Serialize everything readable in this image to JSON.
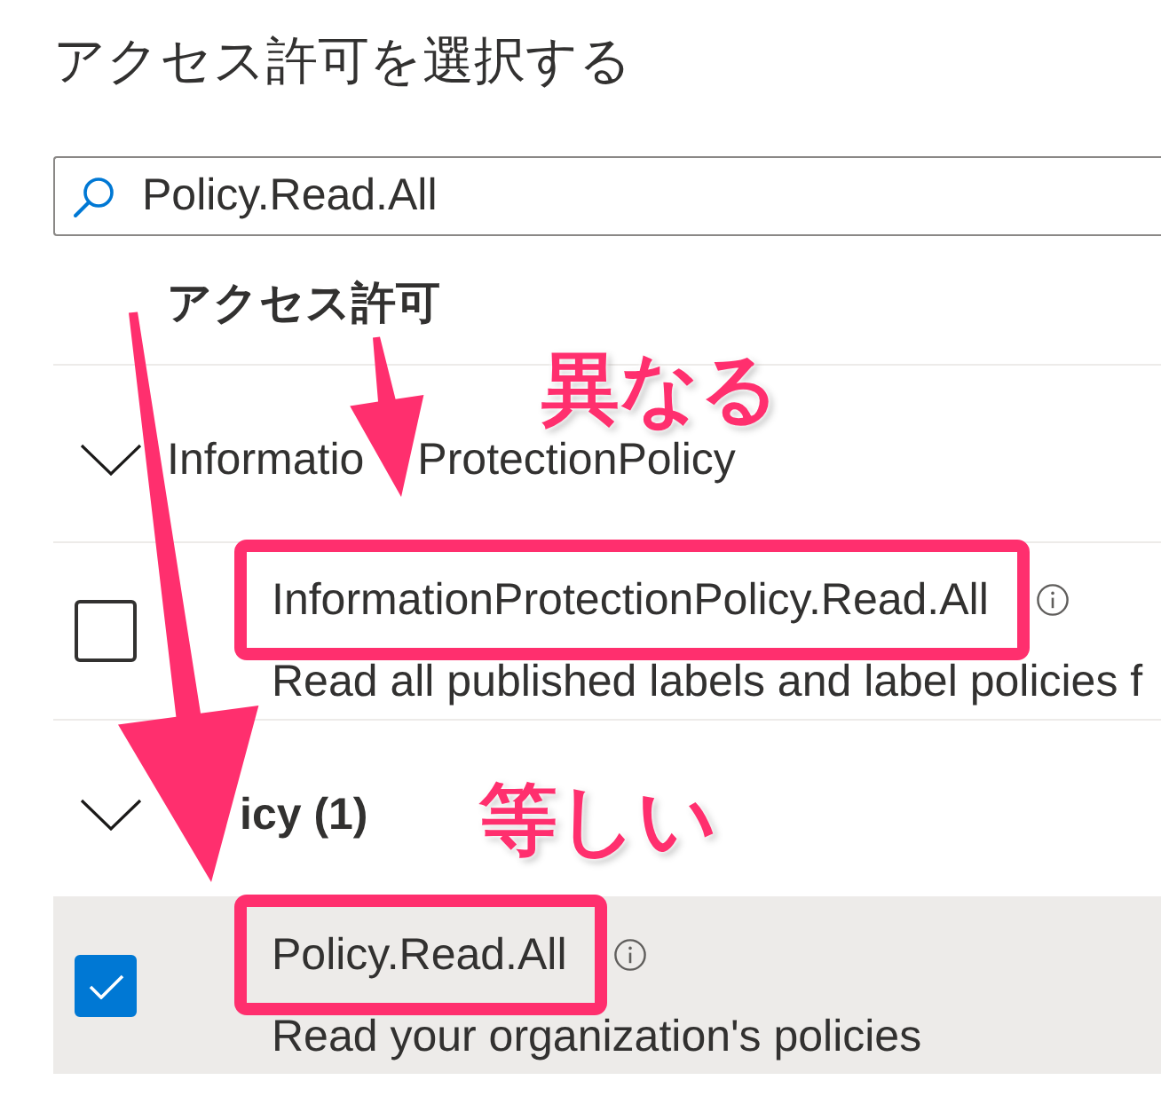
{
  "title": "アクセス許可を選択する",
  "search": {
    "value": "Policy.Read.All"
  },
  "column_header": "アクセス許可",
  "groups": [
    {
      "label_parts": [
        "Informatio",
        "ProtectionPolicy"
      ],
      "expanded": true,
      "callout": "異なる",
      "items": [
        {
          "name": "InformationProtectionPolicy.Read.All",
          "description": "Read all published labels and label policies f",
          "checked": false,
          "highlighted": true
        }
      ]
    },
    {
      "label_parts": [
        "icy (1)"
      ],
      "expanded": true,
      "callout": "等しい",
      "items": [
        {
          "name": "Policy.Read.All",
          "description": "Read your organization's policies",
          "checked": true,
          "highlighted": true
        }
      ]
    }
  ]
}
